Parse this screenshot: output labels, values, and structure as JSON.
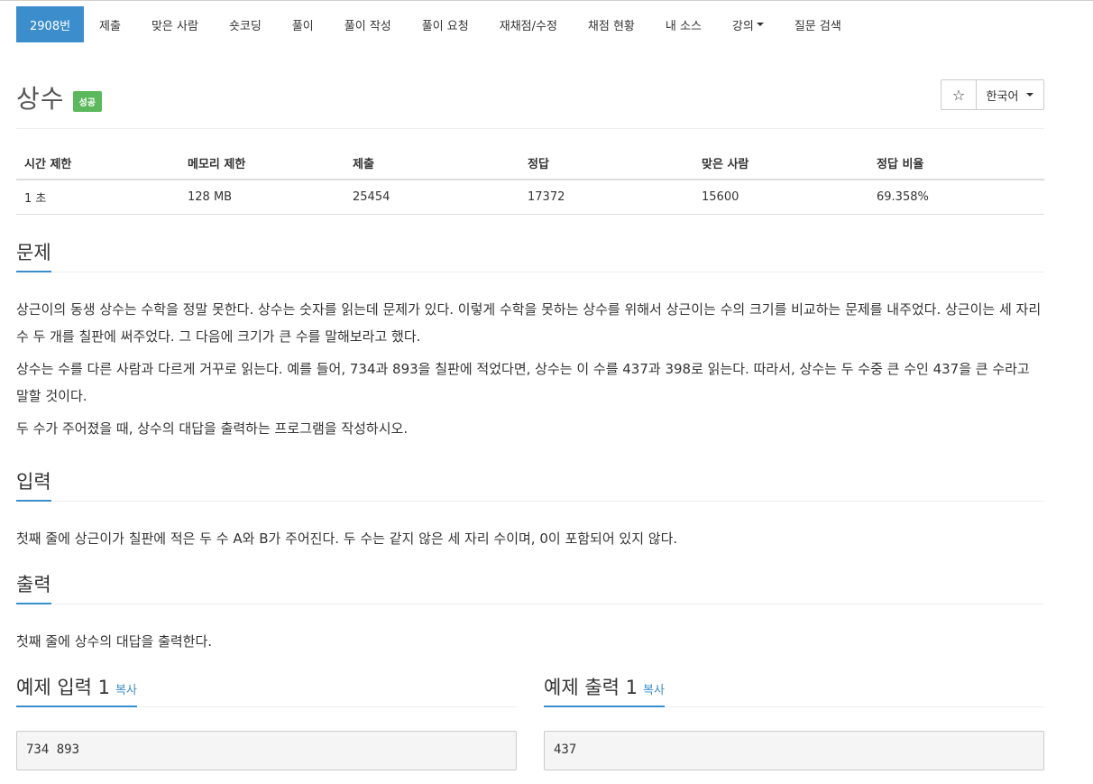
{
  "nav": {
    "items": [
      {
        "label": "2908번"
      },
      {
        "label": "제출"
      },
      {
        "label": "맞은 사람"
      },
      {
        "label": "숏코딩"
      },
      {
        "label": "풀이"
      },
      {
        "label": "풀이 작성"
      },
      {
        "label": "풀이 요청"
      },
      {
        "label": "재채점/수정"
      },
      {
        "label": "채점 현황"
      },
      {
        "label": "내 소스"
      },
      {
        "label": "강의"
      },
      {
        "label": "질문 검색"
      }
    ]
  },
  "problem": {
    "title": "상수",
    "badge": "성공",
    "badge_color": "#5cb85c",
    "accent_color": "#3c8dcc"
  },
  "toolbar": {
    "star_icon": "star-icon",
    "star_glyph": "☆",
    "language": "한국어"
  },
  "info_table": {
    "headers": [
      "시간 제한",
      "메모리 제한",
      "제출",
      "정답",
      "맞은 사람",
      "정답 비율"
    ],
    "row": [
      "1 초",
      "128 MB",
      "25454",
      "17372",
      "15600",
      "69.358%"
    ]
  },
  "description": {
    "heading": "문제",
    "paragraphs": [
      "상근이의 동생 상수는 수학을 정말 못한다. 상수는 숫자를 읽는데 문제가 있다. 이렇게 수학을 못하는 상수를 위해서 상근이는 수의 크기를 비교하는 문제를 내주었다. 상근이는 세 자리 수 두 개를 칠판에 써주었다. 그 다음에 크기가 큰 수를 말해보라고 했다.",
      "상수는 수를 다른 사람과 다르게 거꾸로 읽는다. 예를 들어, 734과 893을 칠판에 적었다면, 상수는 이 수를 437과 398로 읽는다. 따라서, 상수는 두 수중 큰 수인 437을 큰 수라고 말할 것이다.",
      "두 수가 주어졌을 때, 상수의 대답을 출력하는 프로그램을 작성하시오."
    ]
  },
  "input": {
    "heading": "입력",
    "text": "첫째 줄에 상근이가 칠판에 적은 두 수 A와 B가 주어진다. 두 수는 같지 않은 세 자리 수이며, 0이 포함되어 있지 않다."
  },
  "output": {
    "heading": "출력",
    "text": "첫째 줄에 상수의 대답을 출력한다."
  },
  "samples": {
    "input_heading": "예제 입력 1",
    "output_heading": "예제 출력 1",
    "copy_label": "복사",
    "input_value": "734 893",
    "output_value": "437"
  }
}
